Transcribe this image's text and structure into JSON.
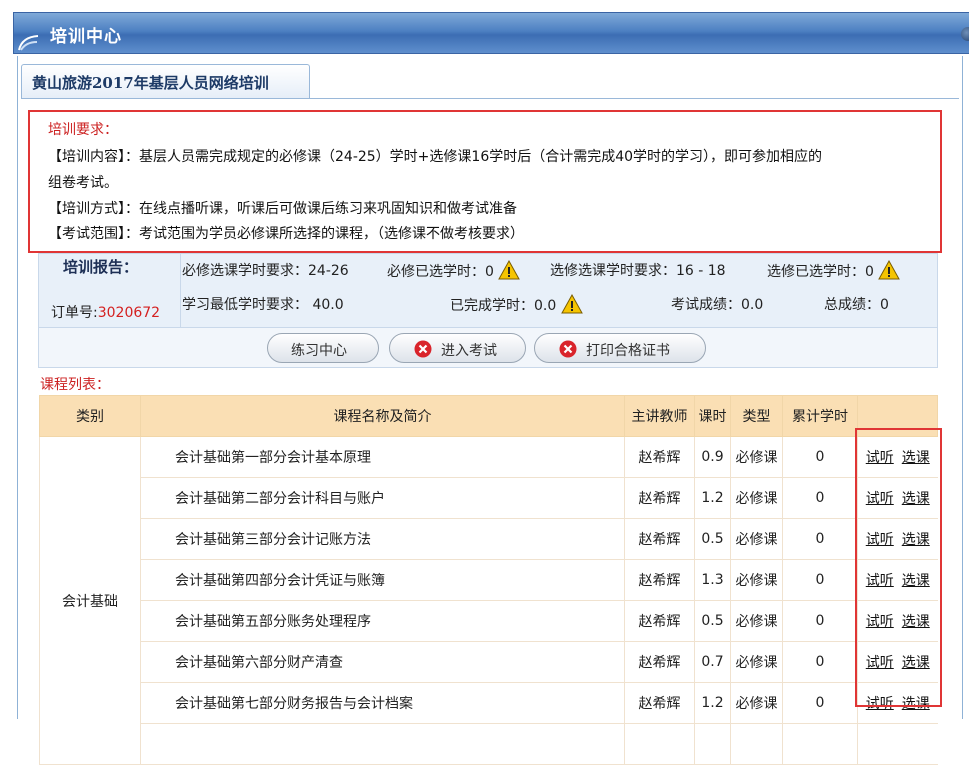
{
  "window": {
    "title": "培训中心"
  },
  "tab": {
    "label": "黄山旅游2017年基层人员网络培训"
  },
  "requirements": {
    "title": "培训要求：",
    "content_line1": "【培训内容】：基层人员需完成规定的必修课（24-25）学时+选修课16学时后（合计需完成40学时的学习），即可参加相应的",
    "content_line2": "组卷考试。",
    "method": "【培训方式】：在线点播听课，听课后可做课后练习来巩固知识和做考试准备",
    "scope": "【考试范围】：考试范围为学员必修课所选择的课程，（选修课不做考核要求）"
  },
  "report": {
    "title": "培训报告：",
    "order_label": "订单号:",
    "order_no": "3020672",
    "required_hours_req": "必修选课学时要求：24-26",
    "required_selected": "必修已选学时：0",
    "elective_hours_req": "选修选课学时要求：16 - 18",
    "elective_selected": "选修已选学时：0",
    "min_hours": "学习最低学时要求： 40.0",
    "completed_hours": "已完成学时：0.0",
    "exam_score": "考试成绩：0.0",
    "total_score": "总成绩：0"
  },
  "buttons": {
    "practice": "练习中心",
    "enter_exam": "进入考试",
    "print_cert": "打印合格证书"
  },
  "course_list": {
    "title": "课程列表：",
    "headers": [
      "类别",
      "课程名称及简介",
      "主讲教师",
      "课时",
      "类型",
      "累计学时",
      ""
    ],
    "category": "会计基础",
    "action_listen": "试听",
    "action_select": "选课",
    "rows": [
      {
        "name": "会计基础第一部分会计基本原理",
        "teacher": "赵希辉",
        "hours": "0.9",
        "type": "必修课",
        "accum": "0"
      },
      {
        "name": "会计基础第二部分会计科目与账户",
        "teacher": "赵希辉",
        "hours": "1.2",
        "type": "必修课",
        "accum": "0"
      },
      {
        "name": "会计基础第三部分会计记账方法",
        "teacher": "赵希辉",
        "hours": "0.5",
        "type": "必修课",
        "accum": "0"
      },
      {
        "name": "会计基础第四部分会计凭证与账簿",
        "teacher": "赵希辉",
        "hours": "1.3",
        "type": "必修课",
        "accum": "0"
      },
      {
        "name": "会计基础第五部分账务处理程序",
        "teacher": "赵希辉",
        "hours": "0.5",
        "type": "必修课",
        "accum": "0"
      },
      {
        "name": "会计基础第六部分财产清查",
        "teacher": "赵希辉",
        "hours": "0.7",
        "type": "必修课",
        "accum": "0"
      },
      {
        "name": "会计基础第七部分财务报告与会计档案",
        "teacher": "赵希辉",
        "hours": "1.2",
        "type": "必修课",
        "accum": "0"
      }
    ]
  },
  "colors": {
    "accent_red": "#cc2222",
    "header_bg": "#fadfb4",
    "title_blue": "#3c6db3"
  }
}
